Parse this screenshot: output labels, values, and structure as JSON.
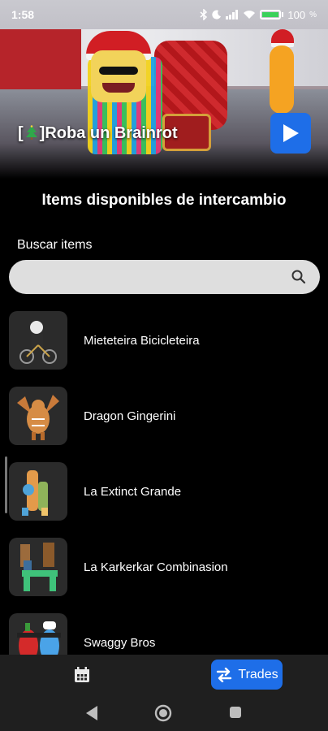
{
  "status_bar": {
    "time": "1:58",
    "battery_text": "100"
  },
  "hero": {
    "title_prefix": "[",
    "title_suffix": "]Roba un Brainrot",
    "play_icon": "play-icon"
  },
  "main": {
    "section_title": "Items disponibles de intercambio",
    "search_label": "Buscar items",
    "search_value": "",
    "search_icon": "search-icon"
  },
  "items": [
    {
      "name": "Mieteteira Bicicleteira"
    },
    {
      "name": "Dragon Gingerini"
    },
    {
      "name": "La Extinct Grande"
    },
    {
      "name": "La Karkerkar Combinasion"
    },
    {
      "name": "Swaggy Bros"
    }
  ],
  "bottom_nav": {
    "calendar_icon": "calendar-icon",
    "trades_label": "Trades",
    "trades_icon": "swap-arrows-icon"
  },
  "colors": {
    "accent": "#1e6ee8",
    "background": "#000000",
    "nav_background": "#1f1f1f",
    "search_background": "#dedede"
  }
}
